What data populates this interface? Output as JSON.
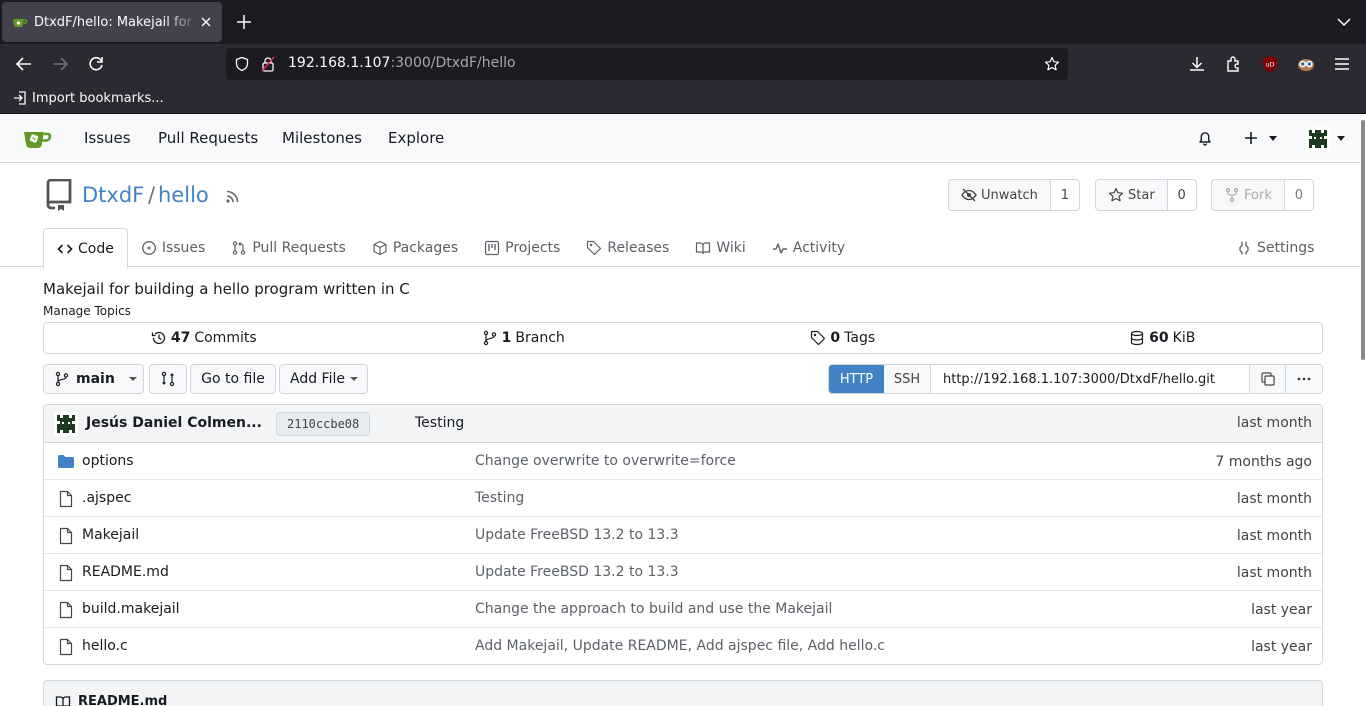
{
  "browser": {
    "tab_title": "DtxdF/hello: Makejail for building a hello program written in C",
    "url_host": "192.168.1.107",
    "url_rest": ":3000/DtxdF/hello",
    "bookmark_import": "Import bookmarks..."
  },
  "nav": {
    "issues": "Issues",
    "pulls": "Pull Requests",
    "milestones": "Milestones",
    "explore": "Explore"
  },
  "repo": {
    "owner": "DtxdF",
    "separator": "/",
    "name": "hello",
    "watch_label": "Unwatch",
    "watch_count": "1",
    "star_label": "Star",
    "star_count": "0",
    "fork_label": "Fork",
    "fork_count": "0",
    "description": "Makejail for building a hello program written in C",
    "manage_topics": "Manage Topics"
  },
  "tabs": [
    {
      "label": "Code",
      "icon": "code-icon"
    },
    {
      "label": "Issues",
      "icon": "issue-icon"
    },
    {
      "label": "Pull Requests",
      "icon": "pull-request-icon"
    },
    {
      "label": "Packages",
      "icon": "package-icon"
    },
    {
      "label": "Projects",
      "icon": "project-icon"
    },
    {
      "label": "Releases",
      "icon": "tag-icon"
    },
    {
      "label": "Wiki",
      "icon": "book-icon"
    },
    {
      "label": "Activity",
      "icon": "pulse-icon"
    },
    {
      "label": "Settings",
      "icon": "tools-icon"
    }
  ],
  "stats": {
    "commits_count": "47",
    "commits_label": "Commits",
    "branch_count": "1",
    "branch_label": "Branch",
    "tags_count": "0",
    "tags_label": "Tags",
    "size_count": "60",
    "size_label": "KiB"
  },
  "toolbar": {
    "branch": "main",
    "goto_file": "Go to file",
    "add_file": "Add File",
    "http": "HTTP",
    "ssh": "SSH",
    "clone_url": "http://192.168.1.107:3000/DtxdF/hello.git"
  },
  "latest_commit": {
    "author": "Jesús Daniel Colmen...",
    "sha": "2110ccbe08",
    "message": "Testing",
    "when": "last month"
  },
  "files": [
    {
      "name": "options",
      "type": "folder",
      "message": "Change overwrite to overwrite=force",
      "when": "7 months ago"
    },
    {
      "name": ".ajspec",
      "type": "file",
      "message": "Testing",
      "when": "last month"
    },
    {
      "name": "Makejail",
      "type": "file",
      "message": "Update FreeBSD 13.2 to 13.3",
      "when": "last month"
    },
    {
      "name": "README.md",
      "type": "file",
      "message": "Update FreeBSD 13.2 to 13.3",
      "when": "last month"
    },
    {
      "name": "build.makejail",
      "type": "file",
      "message": "Change the approach to build and use the Makejail",
      "when": "last year"
    },
    {
      "name": "hello.c",
      "type": "file",
      "message": "Add Makejail, Update README, Add ajspec file, Add hello.c",
      "when": "last year"
    }
  ],
  "readme": {
    "title": "README.md"
  },
  "colors": {
    "accent": "#4183c4",
    "brand": "#609926"
  }
}
